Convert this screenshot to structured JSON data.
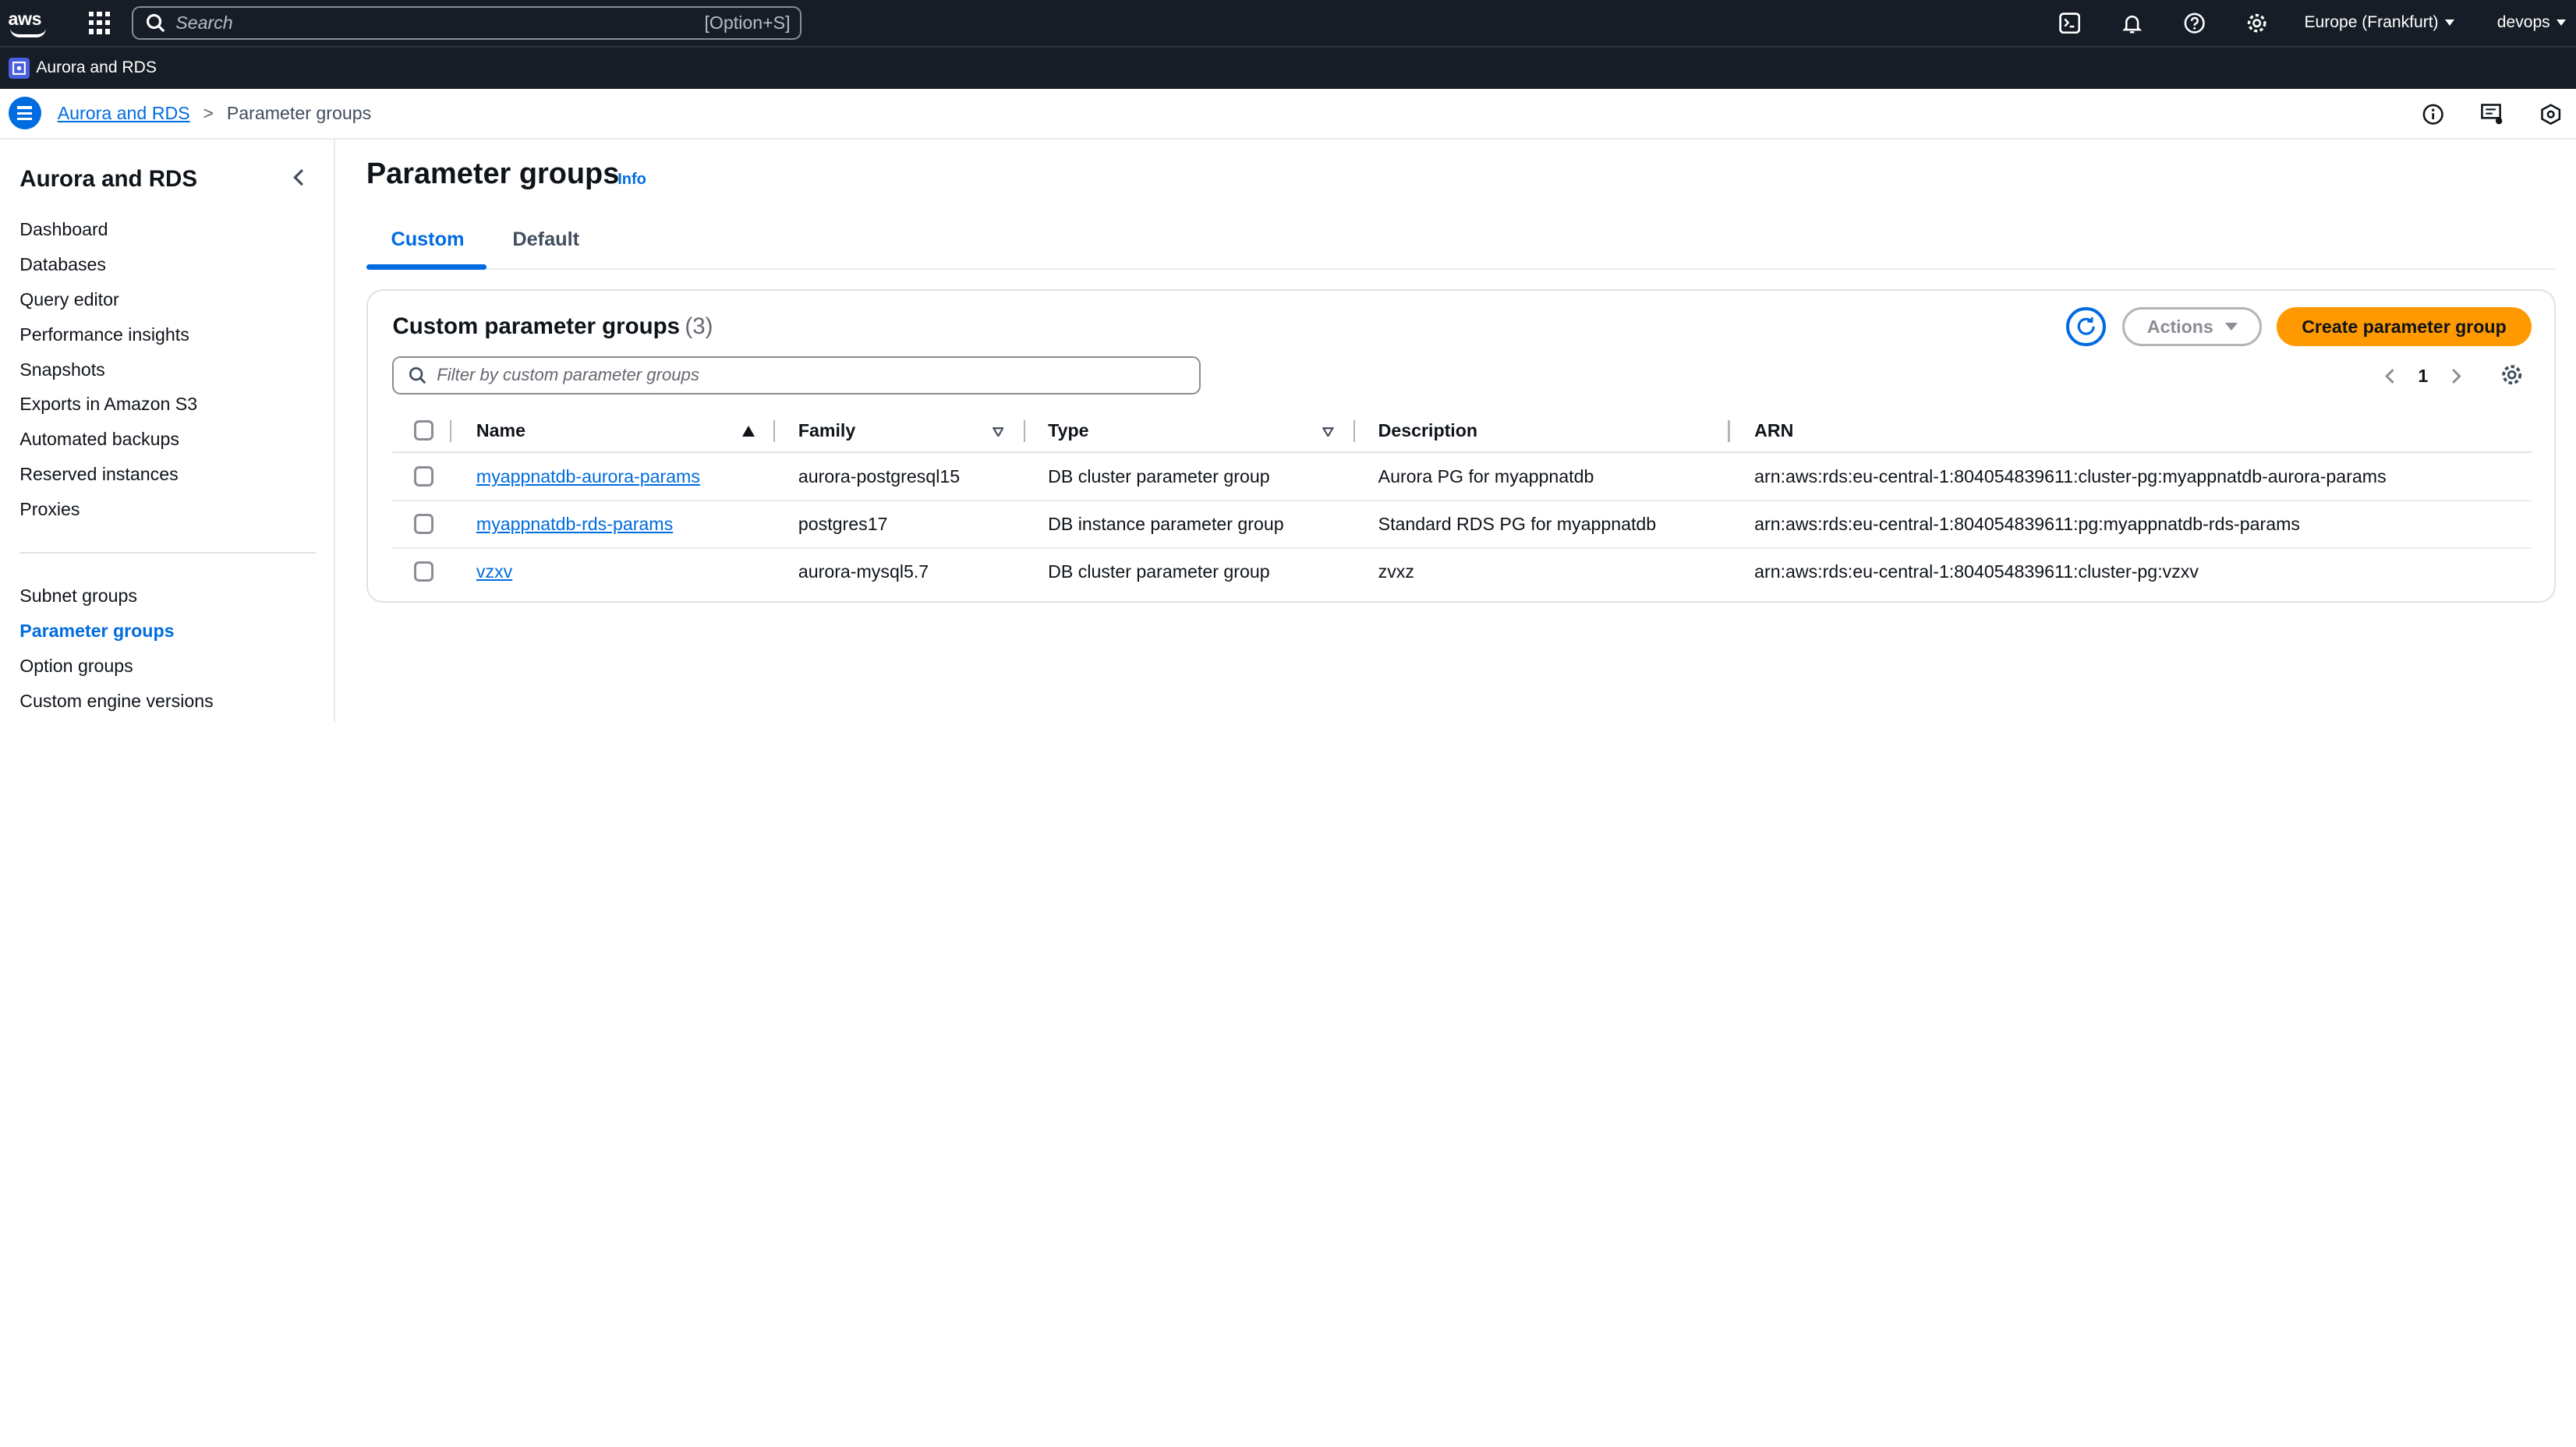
{
  "topbar": {
    "logo_text": "aws",
    "search_placeholder": "Search",
    "search_shortcut": "[Option+S]",
    "region": "Europe (Frankfurt)",
    "user": "devops",
    "icons": [
      "cloudshell-icon",
      "bell-icon",
      "help-icon",
      "settings-icon"
    ]
  },
  "service_bar": {
    "name": "Aurora and RDS"
  },
  "breadcrumb": {
    "parent": "Aurora and RDS",
    "separator": ">",
    "current": "Parameter groups"
  },
  "sidebar": {
    "title": "Aurora and RDS",
    "items": [
      "Dashboard",
      "Databases",
      "Query editor",
      "Performance insights",
      "Snapshots",
      "Exports in Amazon S3",
      "Automated backups",
      "Reserved instances",
      "Proxies"
    ],
    "items2": [
      "Subnet groups",
      "Parameter groups",
      "Option groups",
      "Custom engine versions"
    ],
    "active": "Parameter groups"
  },
  "page": {
    "title": "Parameter groups",
    "info": "Info",
    "tabs": [
      "Custom",
      "Default"
    ],
    "active_tab": "Custom"
  },
  "card": {
    "title": "Custom parameter groups",
    "count": "(3)",
    "actions_label": "Actions",
    "create_label": "Create parameter group",
    "filter_placeholder": "Filter by custom parameter groups",
    "page_number": "1"
  },
  "table": {
    "columns": [
      "Name",
      "Family",
      "Type",
      "Description",
      "ARN"
    ],
    "rows": [
      {
        "name": "myappnatdb-aurora-params",
        "family": "aurora-postgresql15",
        "type": "DB cluster parameter group",
        "description": "Aurora PG for myappnatdb",
        "arn": "arn:aws:rds:eu-central-1:804054839611:cluster-pg:myappnatdb-aurora-params"
      },
      {
        "name": "myappnatdb-rds-params",
        "family": "postgres17",
        "type": "DB instance parameter group",
        "description": "Standard RDS PG for myappnatdb",
        "arn": "arn:aws:rds:eu-central-1:804054839611:pg:myappnatdb-rds-params"
      },
      {
        "name": "vzxv",
        "family": "aurora-mysql5.7",
        "type": "DB cluster parameter group",
        "description": "zvxz",
        "arn": "arn:aws:rds:eu-central-1:804054839611:cluster-pg:vzxv"
      }
    ]
  },
  "colors": {
    "accent": "#006ce0",
    "primary_button": "#ff9900",
    "topbar": "#161d26"
  }
}
